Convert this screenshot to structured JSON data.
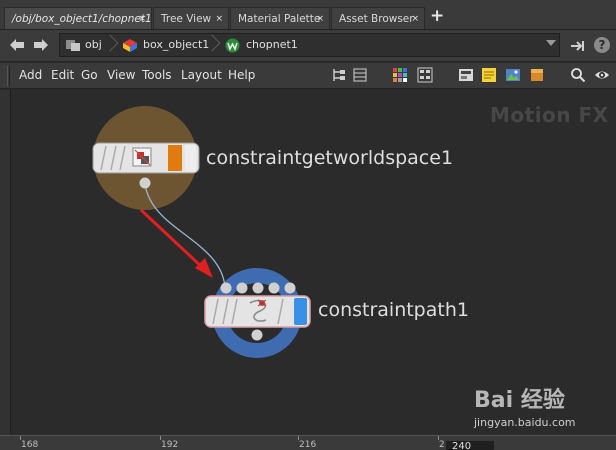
{
  "tabs": [
    {
      "label": "/obj/box_object1/chopnet1",
      "active": true
    },
    {
      "label": "Tree View",
      "active": false
    },
    {
      "label": "Material Palette",
      "active": false
    },
    {
      "label": "Asset Browser",
      "active": false
    }
  ],
  "tab_close_glyph": "×",
  "tab_add_glyph": "+",
  "path": {
    "crumbs": [
      {
        "label": "obj",
        "icon": "obj-icon"
      },
      {
        "label": "box_object1",
        "icon": "geometry-object-icon"
      },
      {
        "label": "chopnet1",
        "icon": "chop-network-icon"
      }
    ]
  },
  "menu": [
    "Add",
    "Edit",
    "Go",
    "View",
    "Tools",
    "Layout",
    "Help"
  ],
  "context_label": "Motion FX",
  "nodes": [
    {
      "name": "constraintgetworldspace1",
      "ring_color": "#6e5532",
      "flag_color": "#e07b10"
    },
    {
      "name": "constraintpath1",
      "ring_color": "#3f6cb0",
      "flag_color": "#3a8fe6"
    }
  ],
  "ruler": {
    "ticks": [
      "168",
      "192",
      "216",
      "2"
    ],
    "frame": "240"
  },
  "watermark": {
    "brand": "Bai 经验",
    "url": "jingyan.baidu.com"
  }
}
